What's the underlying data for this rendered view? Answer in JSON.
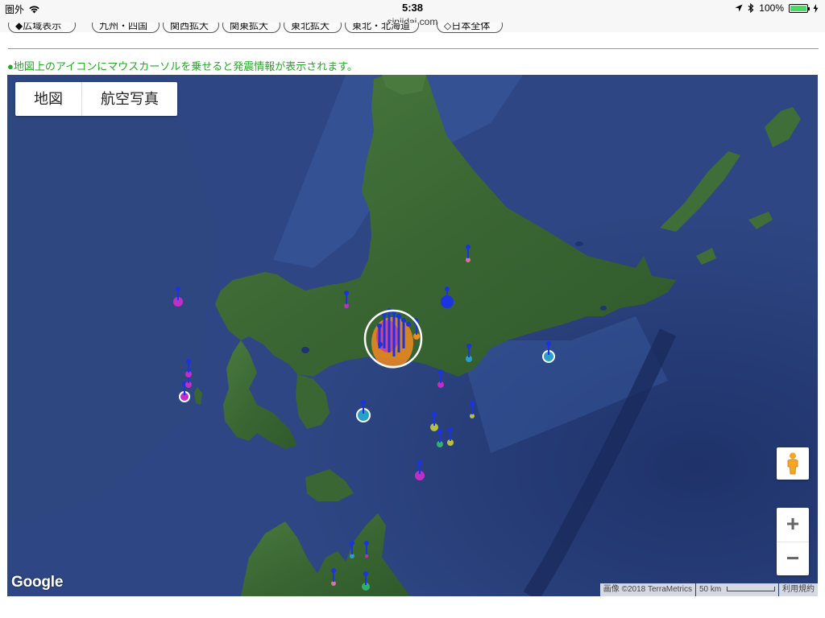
{
  "status_bar": {
    "carrier": "圏外",
    "time": "5:38",
    "url": "sinjidai.com",
    "battery": "100%",
    "battery_level": 1.0
  },
  "nav_buttons": [
    "◆広域表示",
    "九州・四国",
    "関西拡大",
    "関東拡大",
    "東北拡大",
    "東北・北海道",
    "◇日本全体"
  ],
  "notice": "●地図上のアイコンにマウスカーソルを乗せると発震情報が表示されます。",
  "map": {
    "type_control": {
      "map_label": "地図",
      "satellite_label": "航空写真"
    },
    "zoom_in": "+",
    "zoom_out": "−",
    "logo": "Google",
    "imagery_credit": "画像 ©2018 TerraMetrics",
    "scale_label": "50 km",
    "terms": "利用規約",
    "colors": {
      "sea": "#2a3f78",
      "land": "#3c6b35",
      "marker_pin": "#1b33e0",
      "marker_magenta": "#c02ec8",
      "marker_cyan": "#2aa0c8",
      "marker_green": "#2fb070",
      "marker_yellow": "#b8c040",
      "marker_orange": "#f28a1e",
      "notice_green": "#22aa22"
    },
    "markers": [
      {
        "color": "magenta"
      },
      {
        "color": "magenta"
      },
      {
        "color": "magenta"
      },
      {
        "color": "white-ring"
      },
      {
        "color": "magenta"
      },
      {
        "color": "blue"
      },
      {
        "color": "pink"
      },
      {
        "color": "cyan"
      },
      {
        "color": "cyan-ring"
      },
      {
        "color": "magenta"
      },
      {
        "color": "cyan-ring"
      },
      {
        "color": "yellow"
      },
      {
        "color": "yellow"
      },
      {
        "color": "green"
      },
      {
        "color": "yellow"
      },
      {
        "color": "magenta"
      },
      {
        "color": "cyan"
      },
      {
        "color": "magenta"
      },
      {
        "color": "pink"
      },
      {
        "color": "green"
      },
      {
        "color": "orange-cluster"
      }
    ]
  }
}
